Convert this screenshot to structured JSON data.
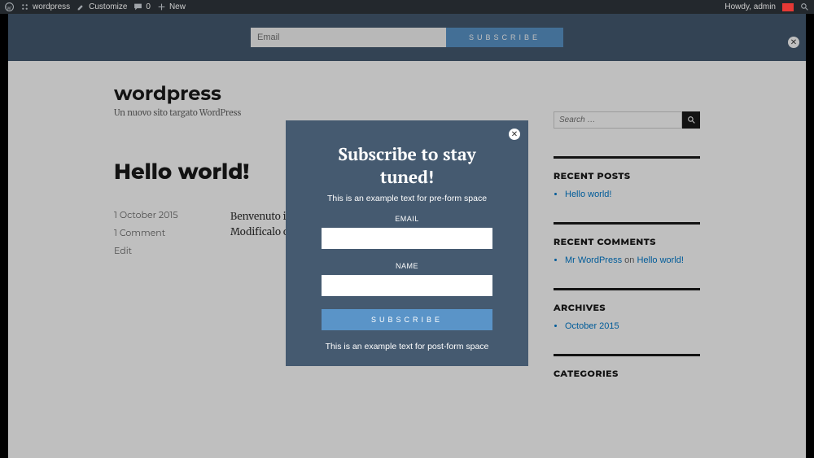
{
  "adminbar": {
    "site_name": "wordpress",
    "customize": "Customize",
    "comments_count": "0",
    "new": "New",
    "howdy": "Howdy, admin"
  },
  "topbar": {
    "email_placeholder": "Email",
    "subscribe": "SUBSCRIBE"
  },
  "site": {
    "title": "wordpress",
    "tagline": "Un nuovo sito targato WordPress"
  },
  "post": {
    "title": "Hello world!",
    "date": "1 October 2015",
    "comments": "1 Comment",
    "edit": "Edit",
    "body": "Benvenuto in WordPress. Questo è il tuo primo articolo. Modificalo o cancellalo e inizia a creare il tuo blog!"
  },
  "sidebar": {
    "search_placeholder": "Search …",
    "recent_posts": {
      "title": "RECENT POSTS",
      "items": [
        "Hello world!"
      ]
    },
    "recent_comments": {
      "title": "RECENT COMMENTS",
      "author": "Mr WordPress",
      "on": "on",
      "target": "Hello world!"
    },
    "archives": {
      "title": "ARCHIVES",
      "items": [
        "October 2015"
      ]
    },
    "categories": {
      "title": "CATEGORIES"
    }
  },
  "modal": {
    "title": "Subscribe to stay tuned!",
    "pre_text": "This is an example text for pre-form space",
    "email_label": "EMAIL",
    "name_label": "NAME",
    "button": "SUBSCRIBE",
    "post_text": "This is an example text for post-form space"
  }
}
